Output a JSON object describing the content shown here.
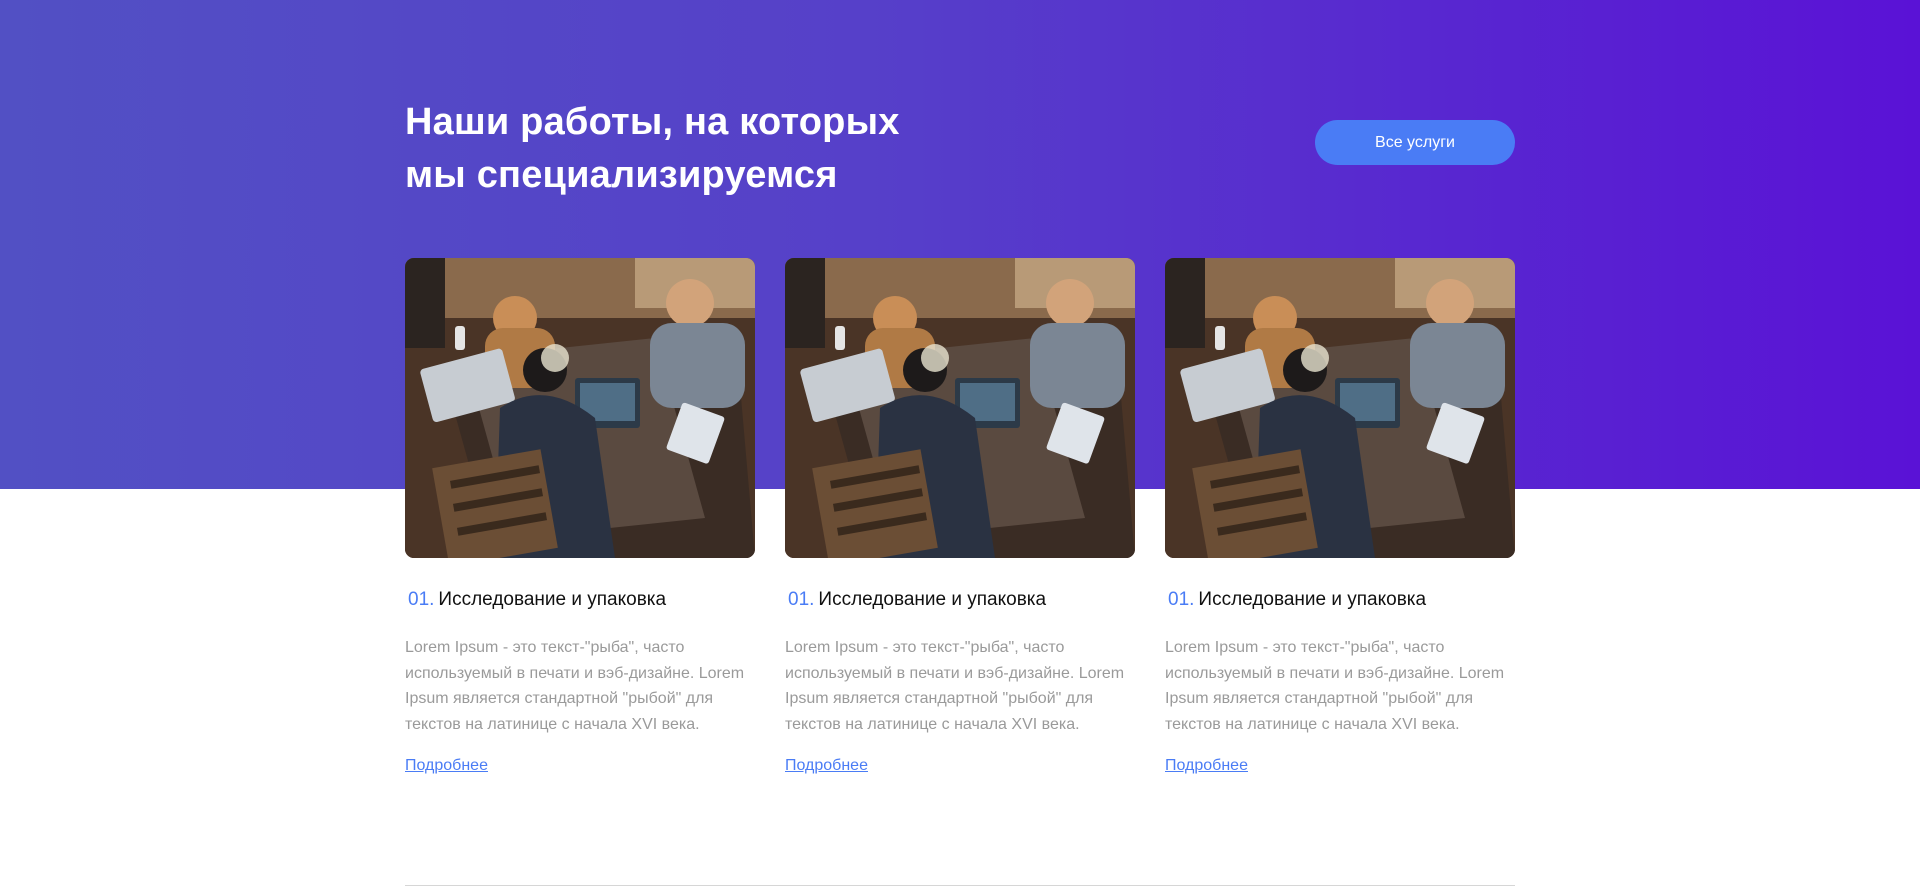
{
  "section": {
    "title_line1": "Наши работы, на которых",
    "title_line2": "мы специализируемся",
    "all_services_button": "Все услуги"
  },
  "colors": {
    "gradient_start": "#5250c4",
    "gradient_end": "#5a12d6",
    "accent": "#4a7cf5",
    "body_text": "#9a9a9a"
  },
  "cards": [
    {
      "number": "01.",
      "title": "Исследование и упаковка",
      "text": "Lorem Ipsum - это текст-\"рыба\", часто используемый в печати и вэб-дизайне. Lorem Ipsum является стандартной \"рыбой\" для текстов на латинице с начала XVI века.",
      "link": "Подробнее",
      "image_icon": "team-working-photo"
    },
    {
      "number": "01.",
      "title": "Исследование и упаковка",
      "text": "Lorem Ipsum - это текст-\"рыба\", часто используемый в печати и вэб-дизайне. Lorem Ipsum является стандартной \"рыбой\" для текстов на латинице с начала XVI века.",
      "link": "Подробнее",
      "image_icon": "team-working-photo"
    },
    {
      "number": "01.",
      "title": "Исследование и упаковка",
      "text": "Lorem Ipsum - это текст-\"рыба\", часто используемый в печати и вэб-дизайне. Lorem Ipsum является стандартной \"рыбой\" для текстов на латинице с начала XVI века.",
      "link": "Подробнее",
      "image_icon": "team-working-photo"
    }
  ]
}
